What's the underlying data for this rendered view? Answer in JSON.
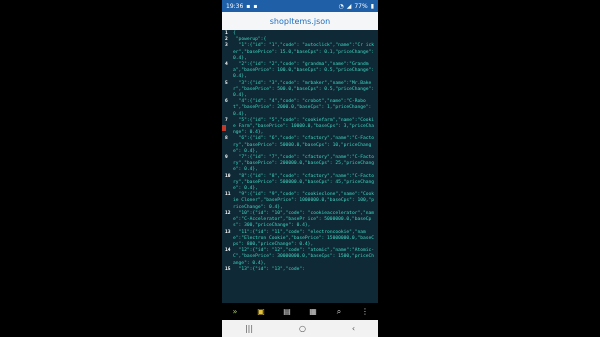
{
  "status": {
    "time": "19:36",
    "battery": "77%"
  },
  "title": "shopItems.json",
  "lines": [
    {
      "n": "1",
      "text": "{"
    },
    {
      "n": "2",
      "text": " \"powerup\":{"
    },
    {
      "n": "3",
      "text": "  \"1\":{\"id\": \"1\",\"code\": \"autoclick\",\"name\":\"Cr icker\",\"basePrice\": 15.0,\"baseCps\": 0.1,\"priceChange\": 0.4},"
    },
    {
      "n": "4",
      "text": "  \"2\":{\"id\": \"2\",\"code\": \"grandma\",\"name\":\"Grandma\",\"basePrice\": 100.0,\"baseCps\": 0.5,\"priceChange\": 0.4},"
    },
    {
      "n": "5",
      "text": "  \"3\":{\"id\": \"3\",\"code\": \"mrbaker\",\"name\":\"Mr.Baker\",\"basePrice\": 500.0,\"baseCps\": 0.5,\"priceChange\": 0.4},"
    },
    {
      "n": "6",
      "text": "  \"4\":{\"id\": \"4\",\"code\": \"crobot\",\"name\":\"C-Robot\",\"basePrice\": 2000.0,\"baseCps\": 1,\"priceChange\": 0.4},"
    },
    {
      "n": "7",
      "text": "  \"5\":{\"id\": \"5\",\"code\": \"cookiefarm\",\"name\":\"Cookie Farm\",\"basePrice\": 10000.0,\"baseCps\": 3,\"priceChange\": 0.4},"
    },
    {
      "n": "8",
      "text": "  \"6\":{\"id\": \"6\",\"code\": \"cfactory\",\"name\":\"C-Factory\",\"basePrice\": 50000.0,\"baseCps\": 10,\"priceChange\": 0.4},"
    },
    {
      "n": "9",
      "text": "  \"7\":{\"id\": \"7\",\"code\": \"cfactory\",\"name\":\"C-Factory\",\"basePrice\": 200000.0,\"baseCps\": 25,\"priceChange\": 0.4},"
    },
    {
      "n": "10",
      "text": "  \"8\":{\"id\": \"8\",\"code\": \"cfactory\",\"name\":\"C-Factory\",\"basePrice\": 500000.0,\"baseCps\": 45,\"priceChange\": 0.4},"
    },
    {
      "n": "11",
      "text": "  \"9\":{\"id\": \"9\",\"code\": \"cookieclone\",\"name\":\"Cookie Cloner\",\"basePrice\": 1000000.0,\"baseCps\": 100,\"priceChange\": 0.4},"
    },
    {
      "n": "12",
      "text": "  \"10\":{\"id\": \"10\",\"code\": \"cookieaccelerator\",\"name\":\"C-Accelerator\",\"basePr ice\": 5000000.0,\"baseCps\": 300,\"priceChange\": 0.4},"
    },
    {
      "n": "13",
      "text": "  \"11\":{\"id\": \"11\",\"code\": \"electroncookie\",\"name\":\"Electron Cookie\",\"basePrice\": 15000000.0,\"baseCps\": 800,\"priceChange\": 0.4},"
    },
    {
      "n": "14",
      "text": "  \"12\":{\"id\": \"12\",\"code\": \"atomic\",\"name\":\"Atomic-C\",\"basePrice\": 30000000.0,\"baseCps\": 1500,\"priceChange\": 0.4},"
    },
    {
      "n": "15",
      "text": "  \"13\":{\"id\": \"13\",\"code\":"
    }
  ],
  "toolbar": {
    "icons": [
      "double-chevron-icon",
      "save-icon",
      "open-file-icon",
      "copy-icon",
      "search-icon",
      "more-vertical-icon"
    ]
  },
  "navbar": {
    "icons": [
      "recents-icon",
      "home-icon",
      "back-icon"
    ]
  }
}
